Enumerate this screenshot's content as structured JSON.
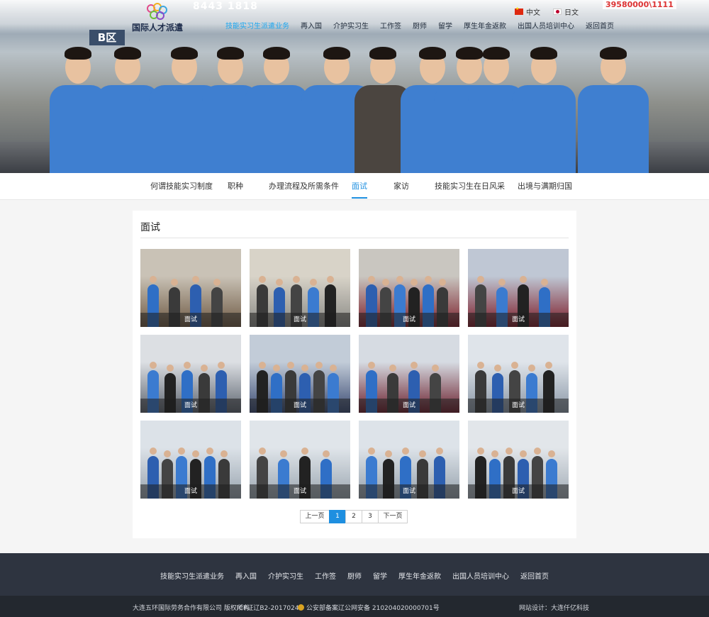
{
  "logo": {
    "name": "国际人才派遣"
  },
  "hero_signs": {
    "number": "8443 1818",
    "number2": "39580000\\1111",
    "zone": "B区"
  },
  "lang": [
    {
      "label": "中文",
      "flag": "cn-flag-icon"
    },
    {
      "label": "日文",
      "flag": "jp-flag-icon"
    }
  ],
  "topnav": [
    {
      "label": "技能实习生派遣业务",
      "active": true
    },
    {
      "label": "再入国"
    },
    {
      "label": "介护实习生"
    },
    {
      "label": "工作签"
    },
    {
      "label": "厨师"
    },
    {
      "label": "留学"
    },
    {
      "label": "厚生年金返款"
    },
    {
      "label": "出国人员培训中心"
    },
    {
      "label": "返回首页"
    }
  ],
  "subnav": [
    {
      "label": "何谓技能实习制度"
    },
    {
      "label": "职种"
    },
    {
      "label": "办理流程及所需条件"
    },
    {
      "label": "面试",
      "active": true
    },
    {
      "label": "家访"
    },
    {
      "label": "技能实习生在日风采"
    },
    {
      "label": "出境与满期归国"
    }
  ],
  "section": {
    "title": "面试"
  },
  "gallery": [
    {
      "caption": "面试"
    },
    {
      "caption": "面试"
    },
    {
      "caption": "面试"
    },
    {
      "caption": "面试"
    },
    {
      "caption": "面试"
    },
    {
      "caption": "面试"
    },
    {
      "caption": "面试"
    },
    {
      "caption": "面试"
    },
    {
      "caption": "面试"
    },
    {
      "caption": "面试"
    },
    {
      "caption": "面试"
    },
    {
      "caption": "面试"
    }
  ],
  "pager": {
    "prev": "上一页",
    "pages": [
      "1",
      "2",
      "3"
    ],
    "current": "1",
    "next": "下一页"
  },
  "footer_nav": [
    {
      "label": "技能实习生派遣业务"
    },
    {
      "label": "再入国"
    },
    {
      "label": "介护实习生"
    },
    {
      "label": "工作签"
    },
    {
      "label": "厨师"
    },
    {
      "label": "留学"
    },
    {
      "label": "厚生年金返款"
    },
    {
      "label": "出国人员培训中心"
    },
    {
      "label": "返回首页"
    }
  ],
  "copyright": {
    "company": "大连五环国际劳务合作有限公司 版权所有",
    "icp": "ICP证辽B2-20170242",
    "police": "公安部备案辽公网安备 210204020000701号",
    "design": "网站设计：大连仟亿科技"
  },
  "colors": {
    "accent": "#1e8fe0",
    "footer": "#2e3440",
    "bottombar": "#23282f"
  }
}
